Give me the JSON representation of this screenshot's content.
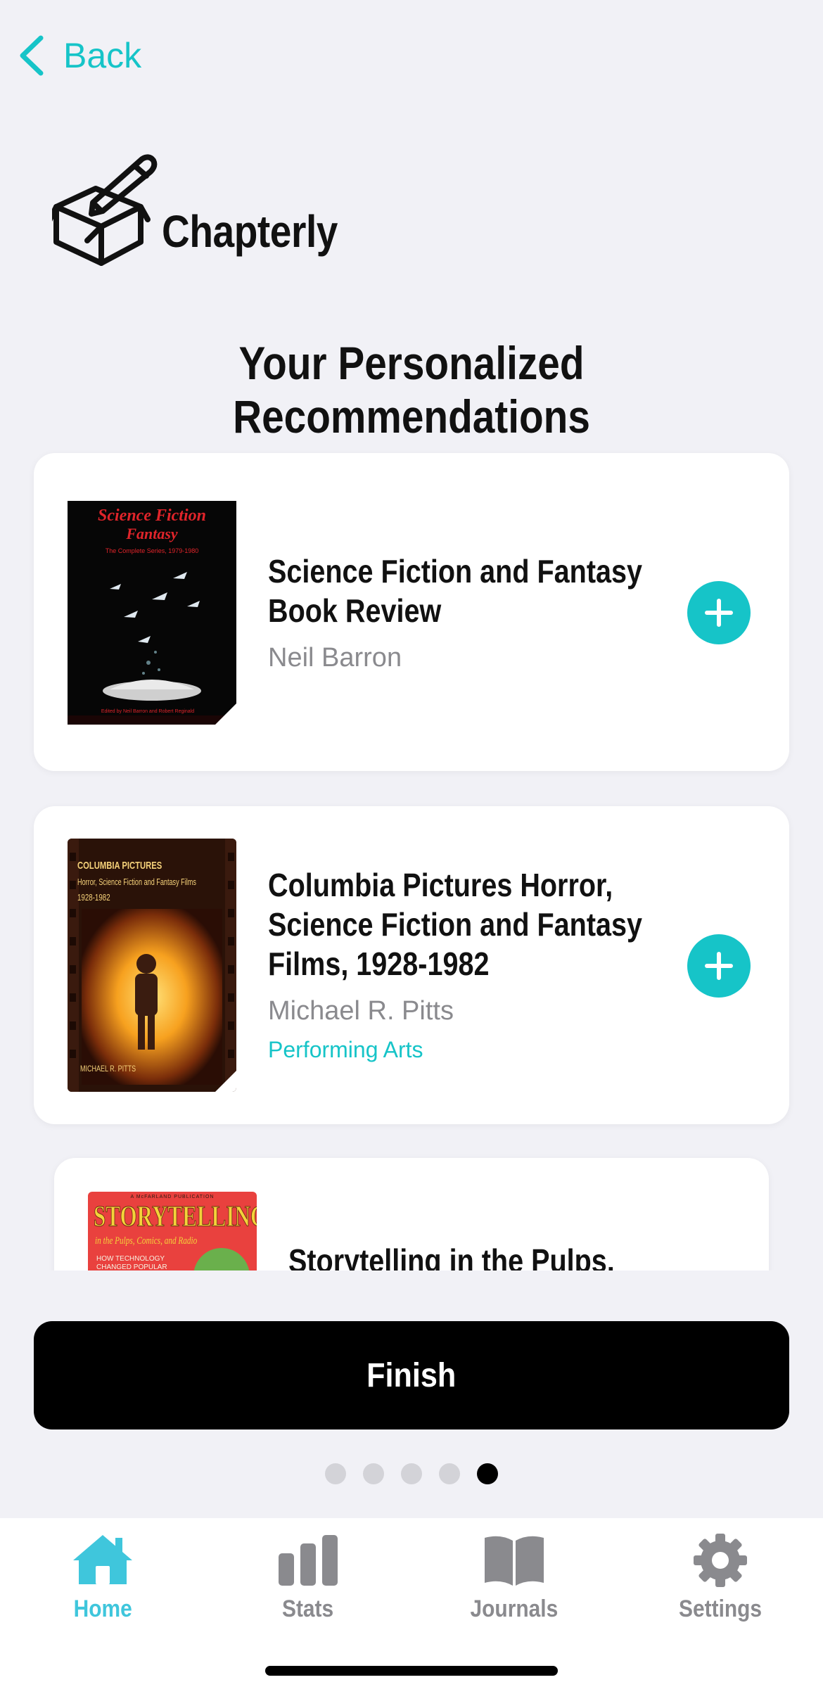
{
  "nav": {
    "back_label": "Back"
  },
  "app": {
    "name": "Chapterly"
  },
  "page": {
    "heading": "Your Personalized Recommendations"
  },
  "books": [
    {
      "title_line1": "Science Fiction and Fantasy",
      "title_line2": "Book Review",
      "author": "Neil Barron",
      "cover_lines": [
        "Science Fiction",
        "Fantasy",
        "The Complete Series, 1979-1980",
        "Edited by Neil Barron and Robert Reginald"
      ]
    },
    {
      "title_line1": "Columbia Pictures Horror,",
      "title_line2": "Science Fiction and Fantasy",
      "title_line3": "Films, 1928-1982",
      "author": "Michael R. Pitts",
      "genre": "Performing Arts",
      "cover_lines": [
        "COLUMBIA PICTURES",
        "Horror, Science Fiction and Fantasy Films",
        "1928-1982",
        "MICHAEL R. PITTS"
      ]
    },
    {
      "title_line1": "Storytelling in the Pulps,",
      "cover_lines": [
        "A McFARLAND PUBLICATION",
        "STORYTELLING",
        "in the Pulps, Comics, and Radio",
        "HOW TECHNOLOGY",
        "CHANGED POPULAR"
      ]
    }
  ],
  "finish_label": "Finish",
  "pager": {
    "total": 5,
    "active": 5
  },
  "tabs": [
    {
      "label": "Home",
      "icon": "home-icon",
      "active": true
    },
    {
      "label": "Stats",
      "icon": "stats-icon"
    },
    {
      "label": "Journals",
      "icon": "book-icon"
    },
    {
      "label": "Settings",
      "icon": "gear-icon"
    }
  ],
  "colors": {
    "accent": "#16c4c8",
    "tab_active": "#3fc6dc",
    "tab_inactive": "#8a8a8e",
    "background": "#f1f1f6"
  }
}
